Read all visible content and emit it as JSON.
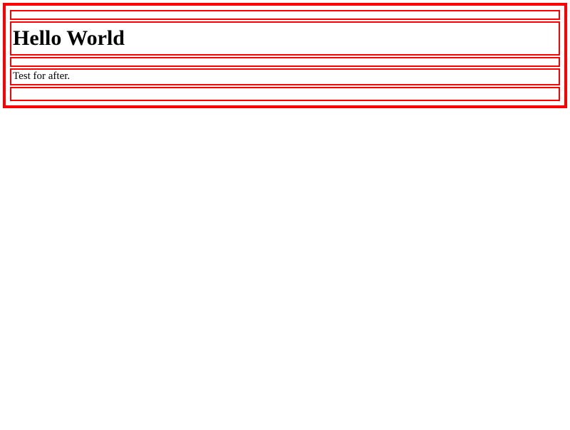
{
  "heading": "Hello World",
  "paragraph": "Test for after."
}
